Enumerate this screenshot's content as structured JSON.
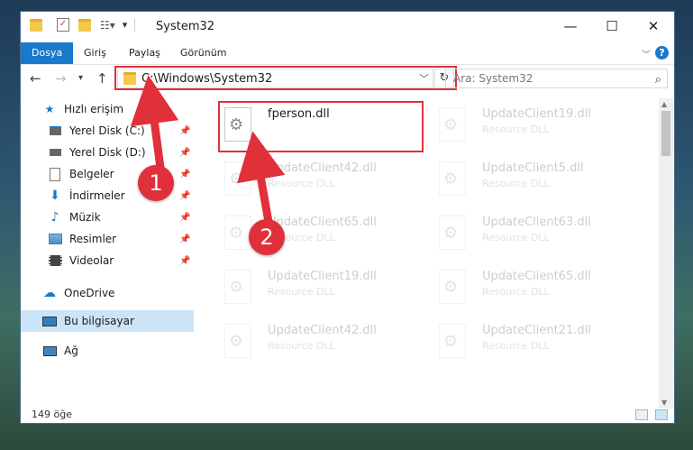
{
  "window": {
    "title": "System32"
  },
  "ribbon": {
    "tabs": [
      "Dosya",
      "Giriş",
      "Paylaş",
      "Görünüm"
    ],
    "help": "?"
  },
  "address": {
    "path": "C:\\Windows\\System32"
  },
  "search": {
    "placeholder": "Ara: System32"
  },
  "sidebar": {
    "quick_access": "Hızlı erişim",
    "items": [
      {
        "label": "Yerel Disk (C:)",
        "icon": "drive-icon"
      },
      {
        "label": "Yerel Disk (D:)",
        "icon": "drive-icon"
      },
      {
        "label": "Belgeler",
        "icon": "documents-icon"
      },
      {
        "label": "İndirmeler",
        "icon": "download-icon"
      },
      {
        "label": "Müzik",
        "icon": "music-icon"
      },
      {
        "label": "Resimler",
        "icon": "pictures-icon"
      },
      {
        "label": "Videolar",
        "icon": "videos-icon"
      }
    ],
    "onedrive": "OneDrive",
    "this_pc": "Bu bilgisayar",
    "network": "Ağ"
  },
  "files": [
    {
      "name": "fperson.dll",
      "type": "",
      "highlighted": true
    },
    {
      "name": "UpdateClient19.dll",
      "type": "Resource DLL",
      "highlighted": false
    },
    {
      "name": "UpdateClient42.dll",
      "type": "Resource DLL",
      "highlighted": false
    },
    {
      "name": "UpdateClient5.dll",
      "type": "Resource DLL",
      "highlighted": false
    },
    {
      "name": "UpdateClient65.dll",
      "type": "Resource DLL",
      "highlighted": false
    },
    {
      "name": "UpdateClient63.dll",
      "type": "Resource DLL",
      "highlighted": false
    },
    {
      "name": "UpdateClient19.dll",
      "type": "Resource DLL",
      "highlighted": false
    },
    {
      "name": "UpdateClient65.dll",
      "type": "Resource DLL",
      "highlighted": false
    },
    {
      "name": "UpdateClient42.dll",
      "type": "Resource DLL",
      "highlighted": false
    },
    {
      "name": "UpdateClient21.dll",
      "type": "Resource DLL",
      "highlighted": false
    }
  ],
  "status": {
    "count_text": "149 öğe"
  },
  "callouts": [
    "1",
    "2"
  ],
  "colors": {
    "accent": "#1979ca",
    "highlight": "#e0303a",
    "selected": "#cce4f7"
  }
}
